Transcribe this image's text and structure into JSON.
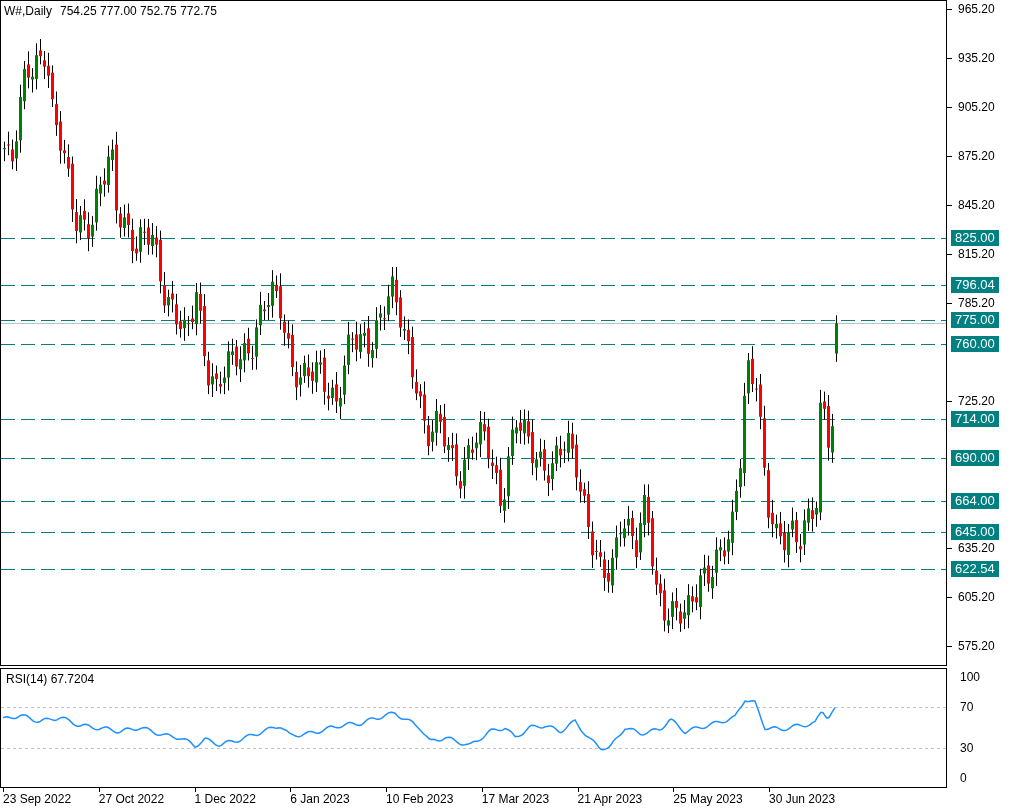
{
  "chart_header": {
    "symbol": "W#,Daily",
    "ohlc": "754.25 777.00 752.75 772.75"
  },
  "price_axis": [
    "965.20",
    "935.20",
    "905.20",
    "875.20",
    "845.20",
    "815.20",
    "785.20",
    "725.20",
    "635.20",
    "605.20",
    "575.20"
  ],
  "levels": [
    "825.00",
    "796.04",
    "775.00",
    "760.00",
    "714.00",
    "690.00",
    "664.00",
    "645.00",
    "622.54"
  ],
  "rsi": {
    "label": "RSI(14) 67.7204",
    "axis": [
      "100",
      "70",
      "30",
      "0"
    ]
  },
  "date_axis": [
    "23 Sep 2022",
    "27 Oct 2022",
    "1 Dec 2022",
    "6 Jan 2023",
    "10 Feb 2023",
    "17 Mar 2023",
    "21 Apr 2023",
    "25 May 2023",
    "30 Jun 2023"
  ]
}
